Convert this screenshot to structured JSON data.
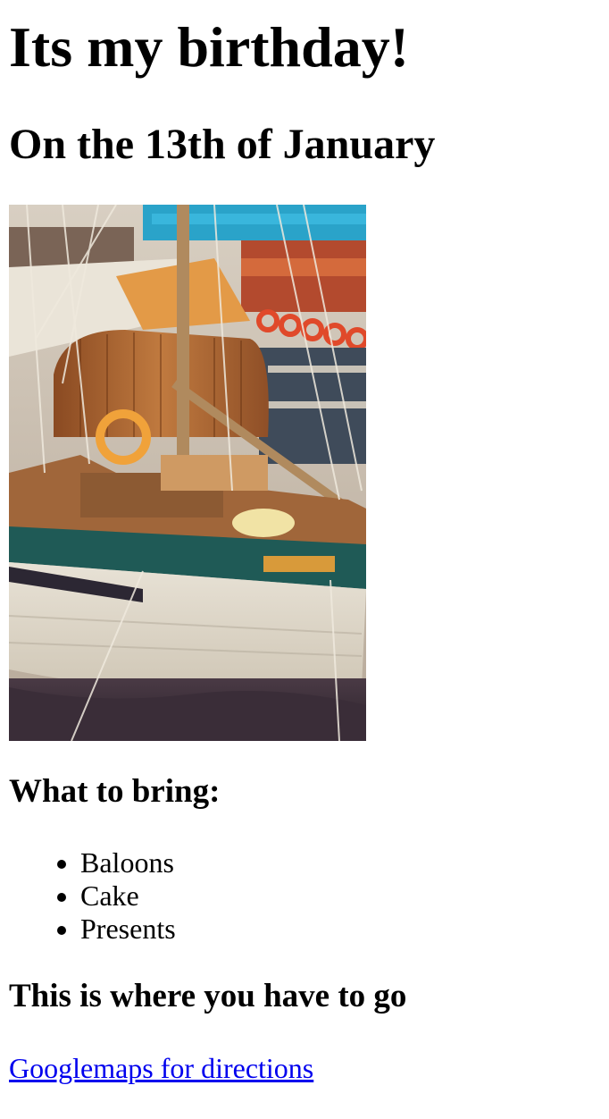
{
  "page": {
    "title": "Its my birthday!",
    "subtitle": "On the 13th of January",
    "bring_heading": "What to bring:",
    "bring_items": [
      "Baloons",
      "Cake",
      "Presents"
    ],
    "where_heading": "This is where you have to go",
    "directions_link": "Googlemaps for directions"
  },
  "colors": {
    "link": "#0000ee",
    "text": "#000000",
    "background": "#ffffff"
  }
}
